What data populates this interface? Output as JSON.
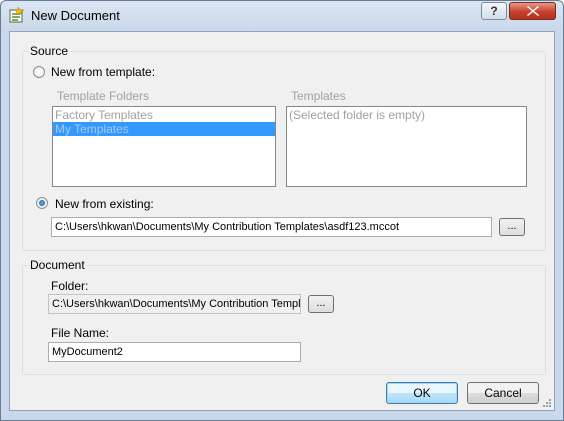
{
  "window": {
    "title": "New Document"
  },
  "titlebar": {
    "help_label": "?"
  },
  "source": {
    "group_label": "Source",
    "from_template_label": "New from template:",
    "template_folders_label": "Template Folders",
    "template_folders": [
      "Factory Templates",
      "My Templates"
    ],
    "templates_label": "Templates",
    "templates_empty_text": "(Selected folder is empty)",
    "from_existing_label": "New from existing:",
    "existing_path": "C:\\Users\\hkwan\\Documents\\My Contribution Templates\\asdf123.mccot",
    "browse_label": "..."
  },
  "document": {
    "group_label": "Document",
    "folder_label": "Folder:",
    "folder_value": "C:\\Users\\hkwan\\Documents\\My Contribution Templ",
    "browse_label": "...",
    "filename_label": "File Name:",
    "filename_value": "MyDocument2"
  },
  "buttons": {
    "ok_label": "OK",
    "cancel_label": "Cancel"
  }
}
